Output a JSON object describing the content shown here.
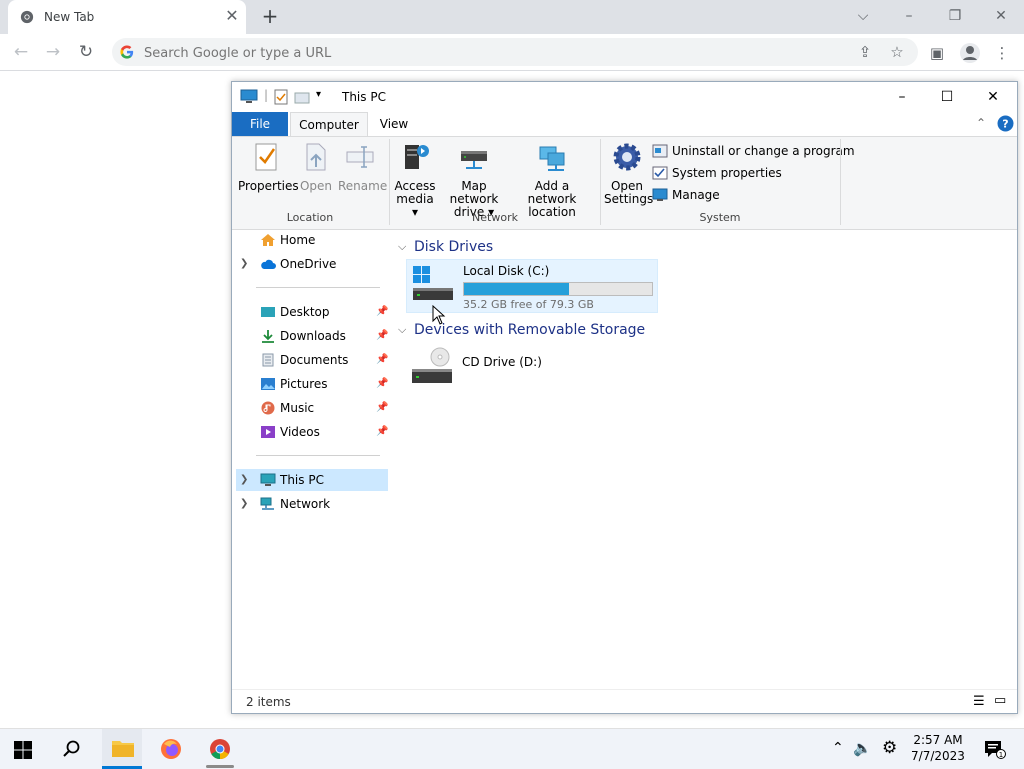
{
  "browser": {
    "tab_title": "New Tab",
    "tab_close": "✕",
    "new_tab": "+",
    "address_placeholder": "Search Google or type a URL"
  },
  "explorer": {
    "window_title": "This PC",
    "ribbon_tabs": [
      "File",
      "Computer",
      "View"
    ],
    "location_buttons": [
      "Properties",
      "Open",
      "Rename"
    ],
    "location_group": "Location",
    "network_buttons": {
      "access_media_1": "Access",
      "access_media_2": "media ▾",
      "map_drive_1": "Map network",
      "map_drive_2": "drive ▾",
      "add_location_1": "Add a network",
      "add_location_2": "location"
    },
    "network_group": "Network",
    "open_settings_1": "Open",
    "open_settings_2": "Settings",
    "system_links": [
      "Uninstall or change a program",
      "System properties",
      "Manage"
    ],
    "system_group": "System",
    "nav": {
      "home": "Home",
      "onedrive": "OneDrive",
      "quick_access": [
        "Desktop",
        "Downloads",
        "Documents",
        "Pictures",
        "Music",
        "Videos"
      ],
      "this_pc": "This PC",
      "network": "Network"
    },
    "sections": {
      "disk_drives": "Disk Drives",
      "removable": "Devices with Removable Storage"
    },
    "drive_c": {
      "name": "Local Disk (C:)",
      "free_text": "35.2 GB free of 79.3 GB",
      "used_fraction": 0.556
    },
    "drive_d": {
      "name": "CD Drive (D:)"
    },
    "status": "2 items"
  },
  "taskbar": {
    "time": "2:57 AM",
    "date": "7/7/2023"
  },
  "colors": {
    "accent": "#0078d4",
    "file_tab": "#1a6dc2",
    "drive_bar": "#26a0da"
  }
}
